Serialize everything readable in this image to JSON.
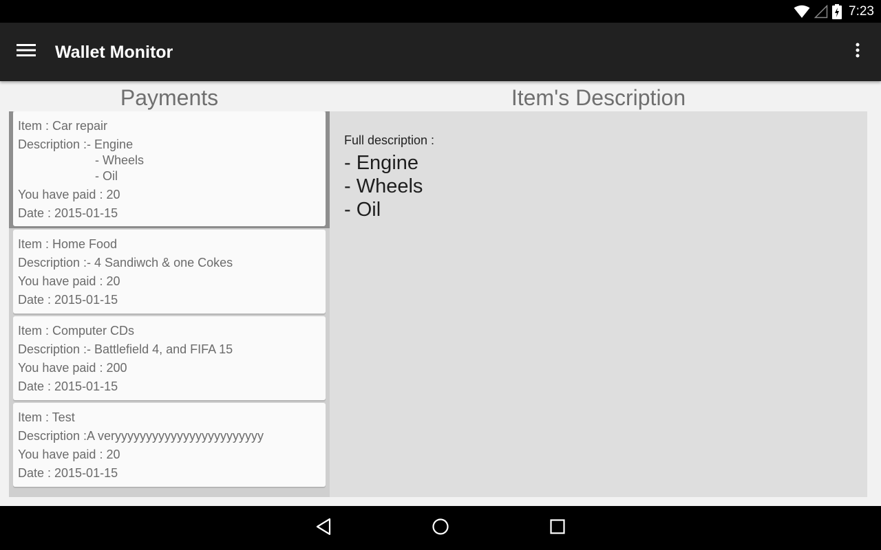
{
  "status_bar": {
    "time": "7:23",
    "icons": [
      "wifi-icon",
      "cell-signal-icon",
      "battery-charging-icon"
    ]
  },
  "app_bar": {
    "title": "Wallet Monitor",
    "menu_icon": "hamburger-menu-icon",
    "overflow_icon": "more-vertical-icon"
  },
  "headings": {
    "payments": "Payments",
    "description": "Item's Description"
  },
  "payments": [
    {
      "item": "Item : Car repair",
      "description_lines": [
        "Description :- Engine",
        "- Wheels",
        "- Oil"
      ],
      "paid": "You have paid : 20",
      "date": "Date : 2015-01-15",
      "selected": true
    },
    {
      "item": "Item : Home Food",
      "description_lines": [
        "Description :- 4 Sandiwch & one Cokes"
      ],
      "paid": "You have paid : 20",
      "date": "Date : 2015-01-15",
      "selected": false
    },
    {
      "item": "Item : Computer CDs",
      "description_lines": [
        "Description :- Battlefield 4, and FIFA 15"
      ],
      "paid": "You have paid : 200",
      "date": "Date : 2015-01-15",
      "selected": false
    },
    {
      "item": "Item : Test",
      "description_lines": [
        "Description :A veryyyyyyyyyyyyyyyyyyyyyyyy"
      ],
      "paid": "You have paid : 20",
      "date": "Date : 2015-01-15",
      "selected": false
    }
  ],
  "detail": {
    "label": "Full description :",
    "lines": [
      "- Engine",
      "- Wheels",
      "- Oil"
    ]
  },
  "nav_bar": {
    "icons": [
      "back-icon",
      "home-icon",
      "recents-icon"
    ]
  }
}
